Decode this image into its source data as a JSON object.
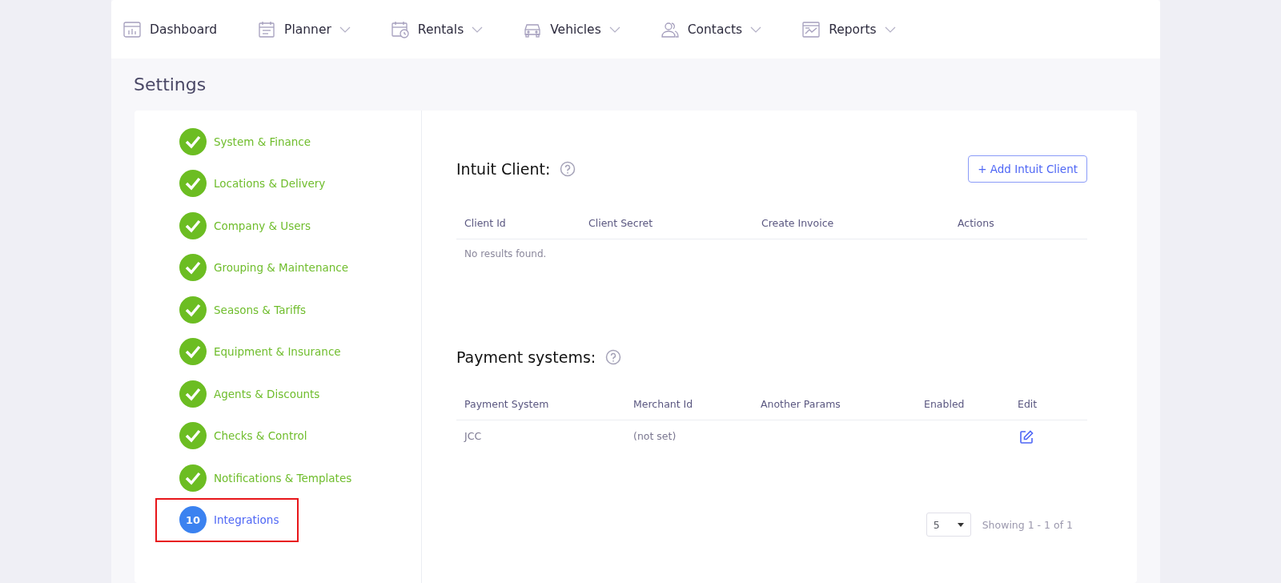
{
  "nav": [
    {
      "label": "Dashboard",
      "dropdown": false
    },
    {
      "label": "Planner",
      "dropdown": true
    },
    {
      "label": "Rentals",
      "dropdown": true
    },
    {
      "label": "Vehicles",
      "dropdown": true
    },
    {
      "label": "Contacts",
      "dropdown": true
    },
    {
      "label": "Reports",
      "dropdown": true
    }
  ],
  "page_title": "Settings",
  "steps": [
    {
      "label": "System & Finance",
      "kind": "done",
      "selected": false,
      "annotated": false
    },
    {
      "label": "Locations & Delivery",
      "kind": "done",
      "selected": false,
      "annotated": false
    },
    {
      "label": "Company & Users",
      "kind": "done",
      "selected": false,
      "annotated": false
    },
    {
      "label": "Grouping & Maintenance",
      "kind": "done",
      "selected": false,
      "annotated": false
    },
    {
      "label": "Seasons & Tariffs",
      "kind": "done",
      "selected": false,
      "annotated": false
    },
    {
      "label": "Equipment & Insurance",
      "kind": "done",
      "selected": false,
      "annotated": false
    },
    {
      "label": "Agents & Discounts",
      "kind": "done",
      "selected": false,
      "annotated": false
    },
    {
      "label": "Checks & Control",
      "kind": "done",
      "selected": false,
      "annotated": false
    },
    {
      "label": "Notifications & Templates",
      "kind": "done",
      "selected": false,
      "annotated": false
    },
    {
      "label": "Integrations",
      "kind": "number",
      "number": "10",
      "selected": true,
      "annotated": true
    }
  ],
  "intuit": {
    "title": "Intuit Client:",
    "add_button": "+ Add Intuit Client",
    "columns": [
      "Client Id",
      "Client Secret",
      "Create Invoice",
      "Actions"
    ],
    "empty": "No results found."
  },
  "payment": {
    "title": "Payment systems:",
    "columns": [
      "Payment System",
      "Merchant Id",
      "Another Params",
      "Enabled",
      "Edit"
    ],
    "rows": [
      [
        "JCC",
        "(not set)",
        "",
        "",
        ""
      ]
    ],
    "page_size": "5",
    "summary": "Showing 1 - 1 of 1"
  }
}
